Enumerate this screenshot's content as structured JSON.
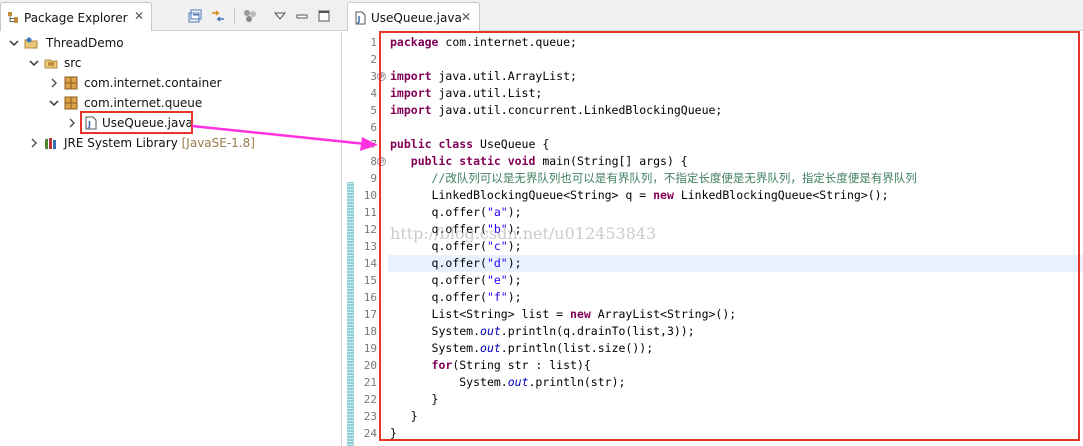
{
  "package_explorer": {
    "tab_label": "Package Explorer",
    "tab_close": "✕",
    "toolbar_icons": [
      "collapse-all-icon",
      "link-with-editor-icon",
      "filters-icon",
      "view-menu-icon",
      "minimize-icon",
      "maximize-icon"
    ],
    "tree": {
      "project": "ThreadDemo",
      "src": "src",
      "package_container": "com.internet.container",
      "package_queue": "com.internet.queue",
      "file": "UseQueue.java",
      "library": "JRE System Library",
      "library_decor": "[JavaSE-1.8]"
    }
  },
  "editor": {
    "tab_label": "UseQueue.java",
    "tab_close": "✕",
    "highlighted_line": 14,
    "line_numbers": [
      "1",
      "2",
      "3",
      "4",
      "5",
      "6",
      "7",
      "8",
      "9",
      "10",
      "11",
      "12",
      "13",
      "14",
      "15",
      "16",
      "17",
      "18",
      "19",
      "20",
      "21",
      "22",
      "23",
      "24"
    ],
    "fold_markers": {
      "l3": "⊕",
      "l8": "⊖"
    },
    "code": {
      "l1_kw": "package",
      "l1_rest": " com.internet.queue;",
      "l3_kw": "import",
      "l3_rest": " java.util.ArrayList;",
      "l4_kw": "import",
      "l4_rest": " java.util.List;",
      "l5_kw": "import",
      "l5_rest": " java.util.concurrent.LinkedBlockingQueue;",
      "l7_kw": "public class",
      "l7_rest": " UseQueue {",
      "l8_indent": "   ",
      "l8_kw": "public static void",
      "l8_rest": " main(String[] args) {",
      "l9_indent": "      ",
      "l9_comment": "//改队列可以是无界队列也可以是有界队列，不指定长度便是无界队列，指定长度便是有界队列",
      "l10_indent": "      ",
      "l10_a": "LinkedBlockingQueue<String> q = ",
      "l10_kw": "new",
      "l10_b": " LinkedBlockingQueue<String>();",
      "offer_prefix": "q.offer(",
      "offer_suffix": ");",
      "offers": [
        "\"a\"",
        "\"b\"",
        "\"c\"",
        "\"d\"",
        "\"e\"",
        "\"f\""
      ],
      "l17_indent": "      ",
      "l17_a": "List<String> list = ",
      "l17_kw": "new",
      "l17_b": " ArrayList<String>();",
      "sys": "System.",
      "out": "out",
      "l18_rest": ".println(q.drainTo(list,3));",
      "l19_rest": ".println(list.size());",
      "l20_indent": "      ",
      "l20_kw": "for",
      "l20_rest": "(String str : list){",
      "l21_indent": "          ",
      "l21_rest": ".println(str);",
      "l22": "      }",
      "l23": "   }",
      "l24": "}"
    }
  },
  "watermark": "http://blog.csdn.net/u012453843",
  "colors": {
    "keyword": "#7f0055",
    "string": "#2a00ff",
    "comment": "#3f7f5f",
    "field": "#0000c0",
    "annotation_red": "#e8342a",
    "arrow_magenta": "#ff33dd"
  }
}
